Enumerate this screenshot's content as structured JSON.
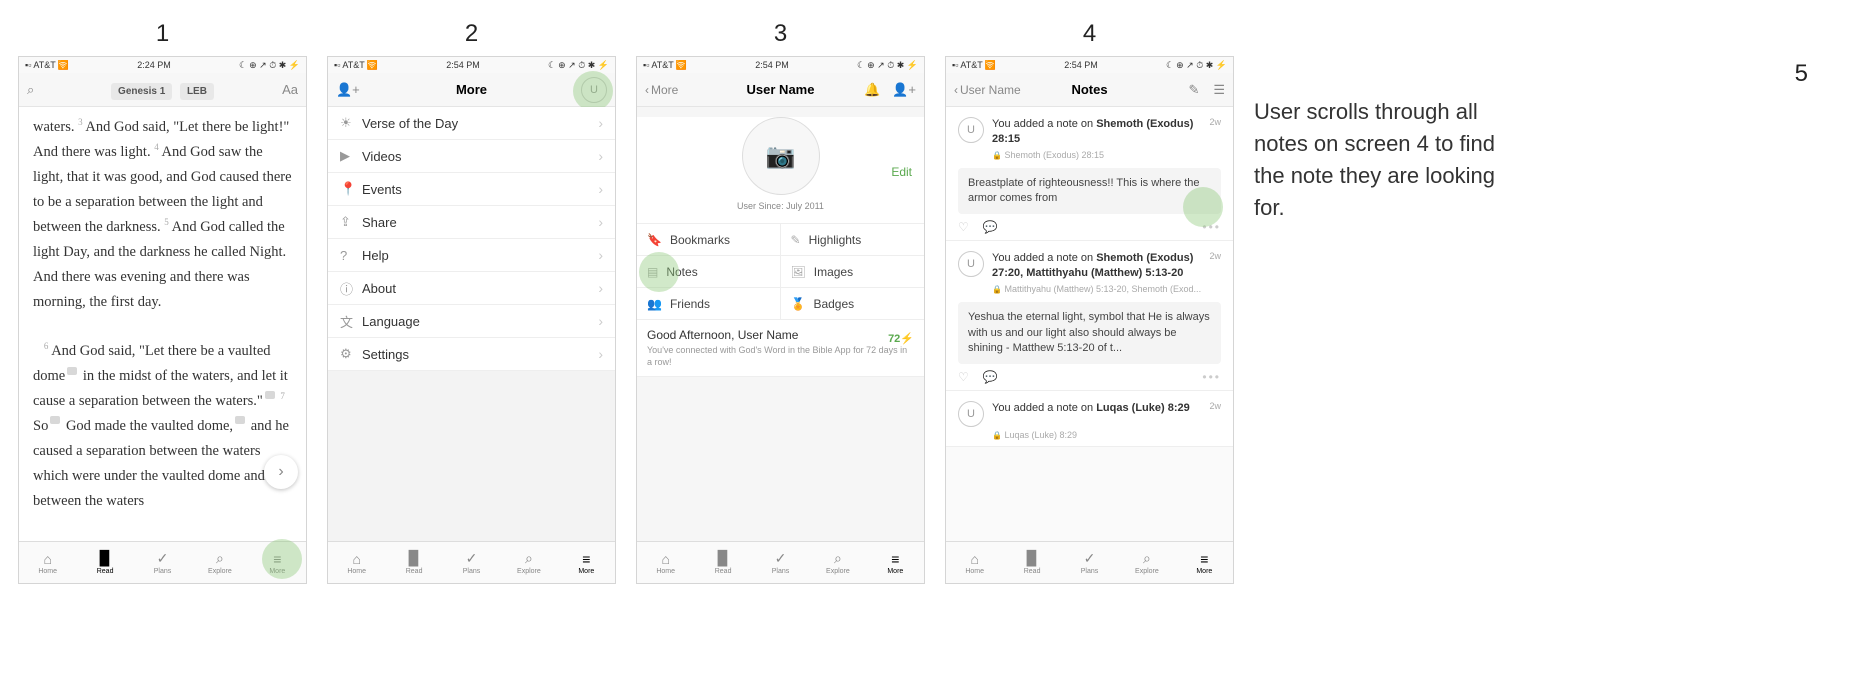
{
  "labels": [
    "1",
    "2",
    "3",
    "4",
    "5"
  ],
  "status": {
    "carrier": "AT&T",
    "wifi": "􀙇",
    "moon": "☾",
    "icons": "⊕ ↗ ⏱ ✱ ⚡"
  },
  "times": [
    "2:24 PM",
    "2:54 PM",
    "2:54 PM",
    "2:54 PM"
  ],
  "tabs": [
    {
      "icon": "⌂",
      "label": "Home"
    },
    {
      "icon": "▉",
      "label": "Read"
    },
    {
      "icon": "✓",
      "label": "Plans"
    },
    {
      "icon": "⌕",
      "label": "Explore"
    },
    {
      "icon": "≡",
      "label": "More"
    }
  ],
  "s1": {
    "ref": "Genesis 1",
    "ver": "LEB",
    "text_pre": "waters. ",
    "v3n": "3",
    "v3": "And God said, \"Let there be light!\" And there was light. ",
    "v4n": "4",
    "v4": "And God saw the light, that it was good, and God caused there to be a separation between the light and between the darkness. ",
    "v5n": "5",
    "v5": "And God called the light Day, and the darkness he called Night. And there was evening and there was morning, the first day.",
    "v6n": "6",
    "v6a": "And God said, \"Let there be a vaulted dome",
    "v6b": " in the midst of the waters, and let it cause a separation between the waters.\"",
    "v7n": "7",
    "v7a": "So",
    "v7b": " God made the vaulted dome,",
    "v7c": " and he caused a separation between the waters which were under the vaulted dome and between the waters"
  },
  "s2": {
    "title": "More",
    "items": [
      {
        "icon": "☀",
        "label": "Verse of the Day"
      },
      {
        "icon": "▶",
        "label": "Videos"
      },
      {
        "icon": "📍",
        "label": "Events"
      },
      {
        "icon": "⇪",
        "label": "Share"
      },
      {
        "icon": "?",
        "label": "Help"
      },
      {
        "icon": "ⓘ",
        "label": "About"
      },
      {
        "icon": "文",
        "label": "Language"
      },
      {
        "icon": "⚙",
        "label": "Settings"
      }
    ]
  },
  "s3": {
    "back": "More",
    "title": "User Name",
    "since": "User Since: July 2011",
    "edit": "Edit",
    "grid": [
      {
        "icon": "🔖",
        "label": "Bookmarks"
      },
      {
        "icon": "✎",
        "label": "Highlights"
      },
      {
        "icon": "▤",
        "label": "Notes"
      },
      {
        "icon": "🖼",
        "label": "Images"
      },
      {
        "icon": "👥",
        "label": "Friends"
      },
      {
        "icon": "🏅",
        "label": "Badges"
      }
    ],
    "greet_title": "Good Afternoon, User Name",
    "greet_body": "You've connected with God's Word in the Bible App for 72 days in a row!",
    "streak": "72⚡"
  },
  "s4": {
    "back": "User Name",
    "title": "Notes",
    "notes": [
      {
        "prefix": "You added a note on ",
        "bold": "Shemoth (Exodus) 28:15",
        "time": "2w",
        "ref": "Shemoth (Exodus) 28:15",
        "body": "Breastplate of righteousness!! This is where the armor comes from"
      },
      {
        "prefix": "You added a note on ",
        "bold": "Shemoth (Exodus) 27:20, Mattithyahu (Matthew) 5:13-20",
        "time": "2w",
        "ref": "Mattithyahu (Matthew) 5:13-20, Shemoth (Exod...",
        "body": "Yeshua the eternal light, symbol that He is always with us and our light also should always be shining - Matthew 5:13-20 of t..."
      },
      {
        "prefix": "You added a note on ",
        "bold": "Luqas (Luke) 8:29",
        "time": "2w",
        "ref": "Luqas (Luke) 8:29",
        "body": ""
      }
    ]
  },
  "s5": {
    "text": "User scrolls through all notes on screen 4 to find the note they are looking for."
  }
}
